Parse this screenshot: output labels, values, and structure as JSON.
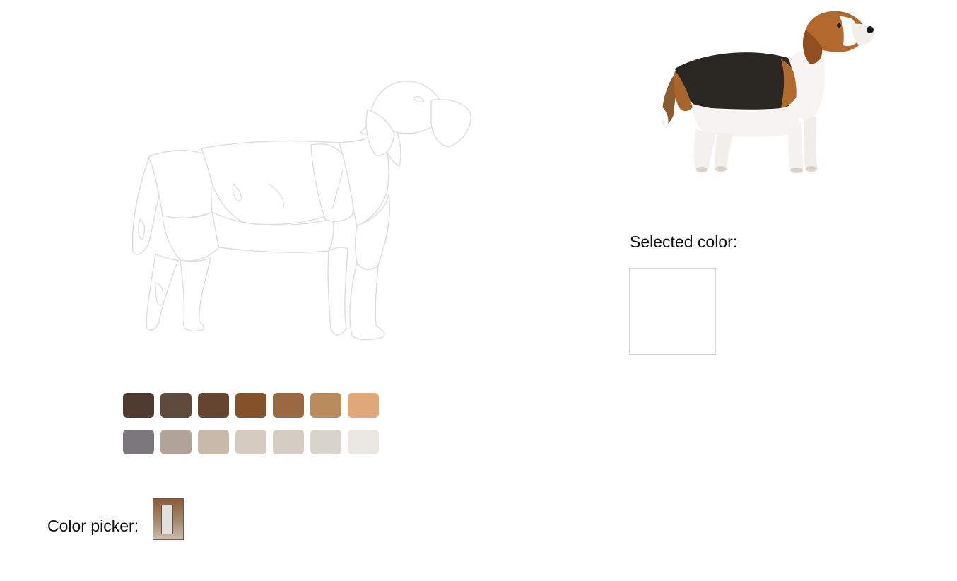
{
  "picker": {
    "label": "Color picker:"
  },
  "selected": {
    "label": "Selected color:",
    "value": "#ffffff"
  },
  "palette": {
    "row1": [
      "#4e3a2e",
      "#5e4a3b",
      "#654430",
      "#83522a",
      "#9a6942",
      "#b88a5c",
      "#e0a878"
    ],
    "row2": [
      "#7b787c",
      "#b2a399",
      "#c8b9ab",
      "#d6cbc1",
      "#d5ccc3",
      "#d9d4cb",
      "#eae7e2"
    ]
  },
  "icons": {
    "outline": "dog-outline-coloring",
    "photo": "beagle-reference-photo"
  }
}
